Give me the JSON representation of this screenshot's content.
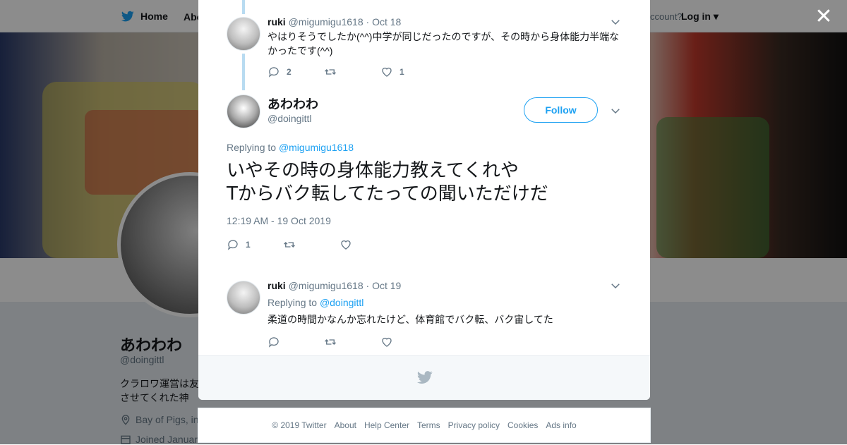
{
  "topnav": {
    "home": "Home",
    "about": "Abo",
    "account": "ccount?",
    "login": "Log in"
  },
  "profile": {
    "name": "あわわわ",
    "handle": "@doingittl",
    "bio": "クラロワ運営は友させてくれた神",
    "location": "Bay of Pigs, in",
    "joined": "Joined Januar"
  },
  "thread": {
    "reply1": {
      "name": "ruki",
      "handle": "@migumigu1618",
      "date": "· Oct 18",
      "text": "やはりそうでしたか(^^)中学が同じだったのですが、その時から身体能力半端なかったです(^^)",
      "reply_count": "2",
      "like_count": "1"
    },
    "main": {
      "name": "あわわわ",
      "handle": "@doingittl",
      "follow_label": "Follow",
      "replying_prefix": "Replying to",
      "replying_to": "@migumigu1618",
      "text": "いやその時の身体能力教えてくれや\nTからバク転してたっての聞いただけだ",
      "timestamp": "12:19 AM - 19 Oct 2019",
      "reply_count": "1"
    },
    "reply2": {
      "name": "ruki",
      "handle": "@migumigu1618",
      "date": "· Oct 19",
      "replying_prefix": "Replying to",
      "replying_to": "@doingittl",
      "text": "柔道の時間かなんか忘れたけど、体育館でバク転、バク宙してた"
    }
  },
  "footer": {
    "copyright": "© 2019 Twitter",
    "links": [
      "About",
      "Help Center",
      "Terms",
      "Privacy policy",
      "Cookies",
      "Ads info"
    ]
  },
  "colors": {
    "accent": "#1da1f2",
    "muted": "#657786",
    "thread_line": "#b8dbf1",
    "text": "#14171a"
  },
  "icons": [
    "twitter-bird-icon",
    "close-icon",
    "chevron-down-icon",
    "reply-icon",
    "retweet-icon",
    "like-icon",
    "location-icon",
    "calendar-icon"
  ]
}
